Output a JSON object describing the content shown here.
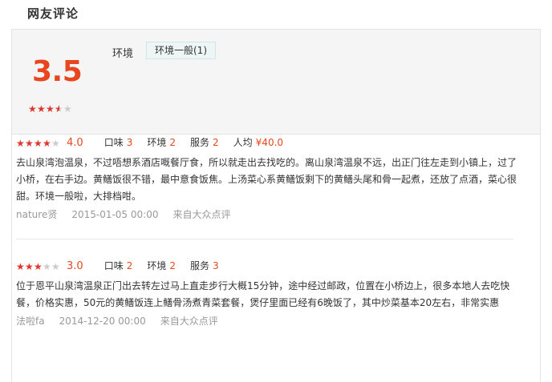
{
  "section_title": "网友评论",
  "summary": {
    "score": "3.5",
    "rating": 3.5,
    "tag_label": "环境",
    "tags": [
      {
        "text": "环境一般(1)"
      }
    ]
  },
  "reviews": [
    {
      "rating": 4.0,
      "score": "4.0",
      "dims": [
        {
          "label": "口味",
          "value": "3"
        },
        {
          "label": "环境",
          "value": "2"
        },
        {
          "label": "服务",
          "value": "2"
        },
        {
          "label": "人均",
          "value": "¥40.0"
        }
      ],
      "text": "去山泉湾泡温泉，不过唔想系酒店嘅餐厅食，所以就走出去找吃的。离山泉湾温泉不远，出正门往左走到小镇上，过了小桥，在右手边。黄鳝饭很不错，最中意食饭焦。上汤菜心系黄鳝饭剩下的黄鳝头尾和骨一起煮，还放了点酒，菜心很甜。环境一般啦，大排档咁。",
      "user": "nature贤",
      "time": "2015-01-05 00:00",
      "source": "来自大众点评"
    },
    {
      "rating": 3.0,
      "score": "3.0",
      "dims": [
        {
          "label": "口味",
          "value": "2"
        },
        {
          "label": "环境",
          "value": "2"
        },
        {
          "label": "服务",
          "value": "3"
        }
      ],
      "text": "位于恩平山泉湾温泉正门出去转左过马上直走步行大概15分钟，途中经过邮政，位置在小桥边上，很多本地人去吃快餐，价格实惠，50元的黄鳝饭连上鳝骨汤煮青菜套餐，煲仔里面已经有6晚饭了，其中炒菜基本20左右，非常实惠",
      "user": "法啦fa",
      "time": "2014-12-20 00:00",
      "source": "来自大众点评"
    }
  ]
}
